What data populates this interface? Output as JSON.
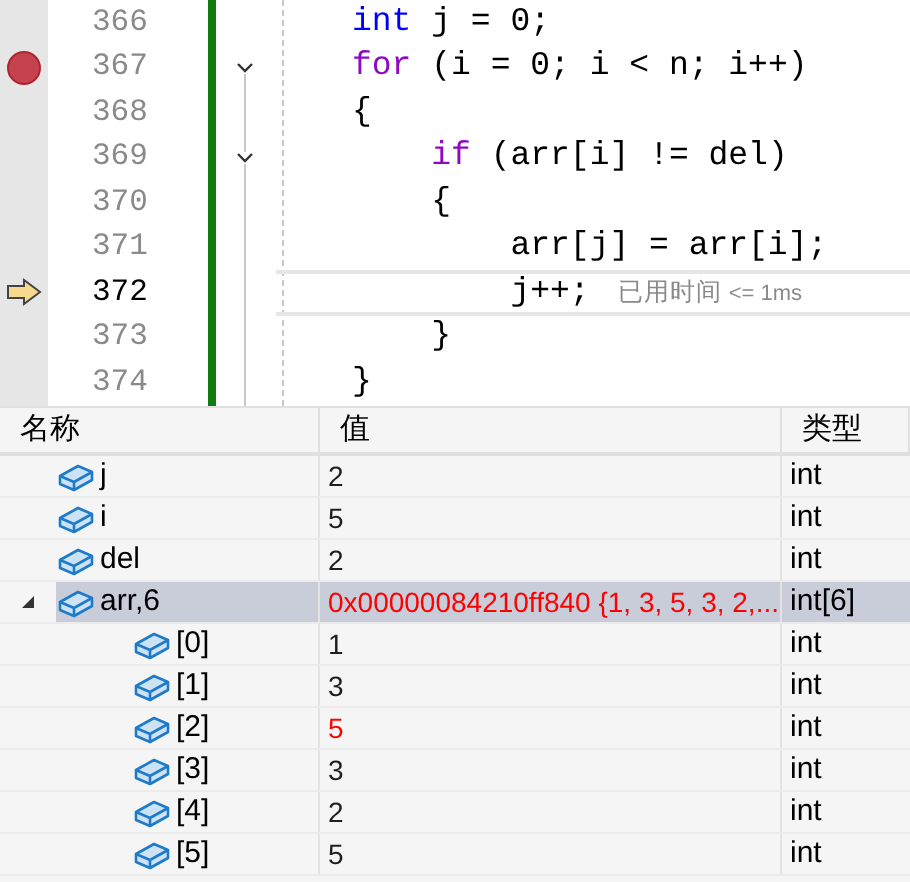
{
  "editor": {
    "lines": [
      {
        "number": "366",
        "breakpoint": false,
        "fold": false,
        "current": false,
        "tokens": [
          {
            "text": "int",
            "kind": "type"
          },
          {
            "text": " j = 0;",
            "kind": "plain"
          }
        ]
      },
      {
        "number": "367",
        "breakpoint": true,
        "fold": true,
        "current": false,
        "tokens": [
          {
            "text": "for",
            "kind": "control"
          },
          {
            "text": " (i = 0; i < n; i++)",
            "kind": "plain"
          }
        ]
      },
      {
        "number": "368",
        "breakpoint": false,
        "fold": false,
        "current": false,
        "tokens": [
          {
            "text": "{",
            "kind": "plain"
          }
        ]
      },
      {
        "number": "369",
        "breakpoint": false,
        "fold": true,
        "current": false,
        "tokens": [
          {
            "text": "    if",
            "kind": "control"
          },
          {
            "text": " (arr[i] != del)",
            "kind": "plain"
          }
        ]
      },
      {
        "number": "370",
        "breakpoint": false,
        "fold": false,
        "current": false,
        "tokens": [
          {
            "text": "    {",
            "kind": "plain"
          }
        ]
      },
      {
        "number": "371",
        "breakpoint": false,
        "fold": false,
        "current": false,
        "tokens": [
          {
            "text": "        arr[j] = arr[i];",
            "kind": "plain"
          }
        ]
      },
      {
        "number": "372",
        "breakpoint": false,
        "fold": false,
        "current": true,
        "tokens": [
          {
            "text": "        j++;",
            "kind": "plain"
          }
        ],
        "perf_tip": {
          "label": "已用时间",
          "value": "<= 1ms"
        }
      },
      {
        "number": "373",
        "breakpoint": false,
        "fold": false,
        "current": false,
        "tokens": [
          {
            "text": "    }",
            "kind": "plain"
          }
        ]
      },
      {
        "number": "374",
        "breakpoint": false,
        "fold": false,
        "current": false,
        "tokens": [
          {
            "text": "}",
            "kind": "plain"
          }
        ]
      }
    ]
  },
  "watch": {
    "columns": [
      "名称",
      "值",
      "类型"
    ],
    "rows": [
      {
        "name": "j",
        "value": "2",
        "type": "int",
        "changed": false,
        "selected": false
      },
      {
        "name": "i",
        "value": "5",
        "type": "int",
        "changed": false,
        "selected": false
      },
      {
        "name": "del",
        "value": "2",
        "type": "int",
        "changed": false,
        "selected": false
      },
      {
        "name": "arr,6",
        "value": "0x00000084210ff840 {1, 3, 5, 3, 2,...",
        "type": "int[6]",
        "changed": true,
        "selected": true,
        "expanded": true,
        "children": [
          {
            "name": "[0]",
            "value": "1",
            "type": "int",
            "changed": false,
            "selected": false
          },
          {
            "name": "[1]",
            "value": "3",
            "type": "int",
            "changed": false,
            "selected": false
          },
          {
            "name": "[2]",
            "value": "5",
            "type": "int",
            "changed": true,
            "selected": false
          },
          {
            "name": "[3]",
            "value": "3",
            "type": "int",
            "changed": false,
            "selected": false
          },
          {
            "name": "[4]",
            "value": "2",
            "type": "int",
            "changed": false,
            "selected": false
          },
          {
            "name": "[5]",
            "value": "5",
            "type": "int",
            "changed": false,
            "selected": false
          }
        ]
      }
    ]
  }
}
